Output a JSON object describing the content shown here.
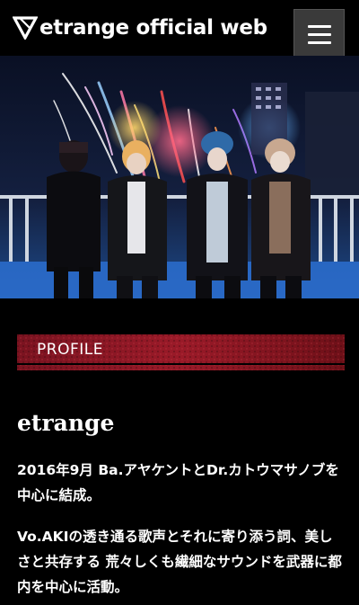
{
  "header": {
    "site_title": "etrange official web",
    "menu_icon": "hamburger-menu-icon"
  },
  "hero": {
    "description_icon": "band-photo"
  },
  "profile": {
    "section_label": "PROFILE",
    "band_name": "etrange",
    "paragraph_1": "2016年9月 Ba.アヤケントとDr.カトウマサノブを中心に結成。",
    "paragraph_2": "Vo.AKIの透き通る歌声とそれに寄り添う詞、美しさと共存する 荒々しくも繊細なサウンドを武器に都内を中心に活動。"
  },
  "colors": {
    "background": "#000000",
    "banner_red": "#8a1420",
    "menu_button": "#3a3a3a"
  }
}
